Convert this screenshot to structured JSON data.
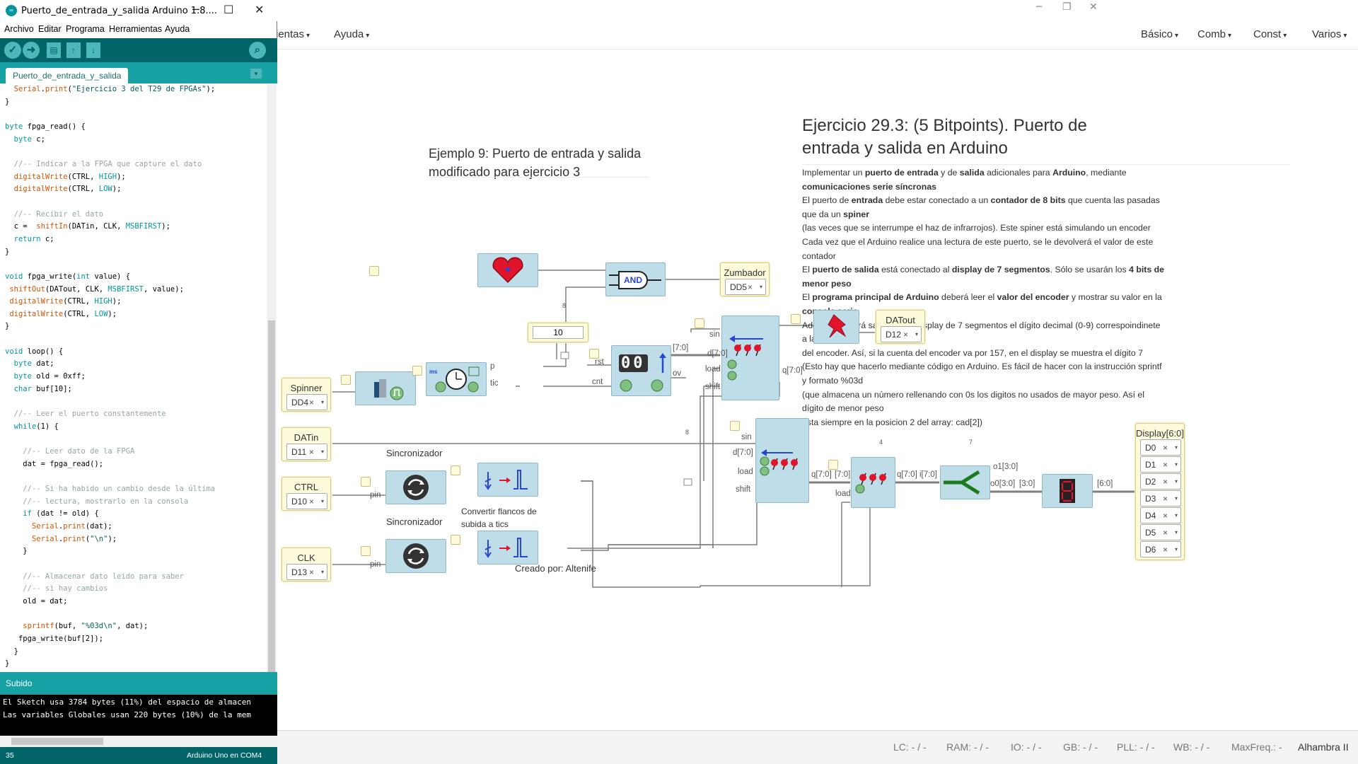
{
  "icestudio": {
    "window_controls": {
      "minimize": "─",
      "restore": "❐",
      "close": "✕"
    },
    "menus_left": [
      "ientas",
      "Ayuda"
    ],
    "menus_right": [
      "Básico",
      "Comb",
      "Const",
      "Varios"
    ],
    "example_title_line1": "Ejemplo 9: Puerto de entrada y salida",
    "example_title_line2": "modificado para ejercicio 3",
    "exercise_title_line1": "Ejercicio 29.3: (5 Bitpoints). Puerto de",
    "exercise_title_line2": "entrada y salida en Arduino",
    "description": [
      "Implementar un <b>puerto de entrada</b> y de <b>salida</b> adicionales para <b>Arduino</b>, mediante",
      "<b>comunicaciones serie síncronas</b>",
      "El puerto de <b>entrada</b> debe estar conectado a un <b>contador de 8 bits</b> que cuenta las pasadas",
      "que da un <b>spiner</b>",
      "(las veces que se interrumpe el haz de infrarrojos). Este spiner está simulando un encoder",
      "Cada vez que el Arduino realice una lectura de este puerto, se le devolverá el valor de este",
      "contador",
      "El <b>puerto de salida</b> está conectado al <b>display de 7 segmentos</b>. Sólo se usarán los <b>4 bits de</b>",
      "<b>menor peso</b>",
      "El <b>programa principal de Arduino</b> deberá leer el <b>valor del encoder</b> y mostrar su valor en la",
      "<b>consola serie.</b>",
      "Además, deberá sacar por el display de 7 segmentos el dígito decimal (0-9) correspoindinete",
      "a la lectura",
      "del encoder. Así, si la cuenta del encoder va por 157, en el display se muestra el dígito 7",
      "(Esto hay que hacerlo mediante código en Arduino. Es fácil de hacer con la instrucción sprintf",
      "y formato %03d",
      "(que almacena un número rellenando con 0s los digitos no usados de mayor peso. Así el",
      "dígito de menor peso",
      "esta siempre en la posicion 2 del array: cad[2])"
    ],
    "credit_prefix": "Creado por: ",
    "credit_name": "Altenife",
    "inputs": {
      "spinner": {
        "label": "Spinner",
        "value": "DD4"
      },
      "datin": {
        "label": "DATin",
        "value": "D11"
      },
      "ctrl": {
        "label": "CTRL",
        "value": "D10"
      },
      "clk": {
        "label": "CLK",
        "value": "D13"
      }
    },
    "outputs": {
      "zumbador": {
        "label": "Zumbador",
        "value": "DD5"
      },
      "datout": {
        "label": "DATout",
        "value": "D12"
      },
      "display": {
        "label": "Display[6:0]",
        "values": [
          "D0",
          "D1",
          "D2",
          "D3",
          "D4",
          "D5",
          "D6"
        ]
      }
    },
    "sel_clear": "×",
    "sel_arrow": "▾",
    "blocks": {
      "and_label": "AND",
      "const_value": "10",
      "sync1": "Sincronizador",
      "sync2": "Sincronizador",
      "edge_label_1": "Convertir flancos de",
      "edge_label_2": "subida a tics",
      "counter_digits": "00"
    },
    "pins": {
      "p": "p",
      "tic": "tic",
      "rst": "rst",
      "cnt": "cnt",
      "ov": "ov",
      "bus70a": "[7:0]",
      "d70a": "d[7:0]",
      "sin_a": "sin",
      "load_a": "load",
      "shift_a": "shift",
      "q70a": "q[7:0]",
      "sin_b": "sin",
      "d70b": "d[7:0]",
      "load_b": "load",
      "shift_b": "shift",
      "q70b": "q[7:0]",
      "bus70b": "[7:0]",
      "load_c": "load",
      "q70c": "q[7:0]",
      "i70": "i[7:0]",
      "o1": "o1[3:0]",
      "o0": "o0[3:0]",
      "bus30": "[3:0]",
      "bus60": "[6:0]",
      "pin1": "pin",
      "pin2": "pin",
      "n8a": "8",
      "n8b": "8",
      "n8c": "8",
      "n4": "4",
      "n7": "7"
    },
    "status": [
      "LC: - / -",
      "RAM: - / -",
      "IO: - / -",
      "GB: - / -",
      "PLL: - / -",
      "WB: - / -",
      "MaxFreq.: -"
    ],
    "board": "Alhambra II",
    "colors": {
      "block": "#bedde9",
      "io_bg": "#fefbdc",
      "wire": "#7f7f7f"
    }
  },
  "arduino": {
    "title": "Puerto_de_entrada_y_salida Arduino 1.8....",
    "window_controls": {
      "minimize": "─",
      "maximize": "☐",
      "close": "✕"
    },
    "menu": [
      "Archivo",
      "Editar",
      "Programa",
      "Herramientas",
      "Ayuda"
    ],
    "toolbar": {
      "verify": "✓",
      "upload": "➜",
      "new": "▤",
      "open": "↑",
      "save": "↓",
      "serial": "⌕"
    },
    "tab": "Puerto_de_entrada_y_salida",
    "tab_menu": "▾",
    "code_lines": [
      "  Serial.print(\"Ejercicio 3 del T29 de FPGAs\");",
      "}",
      "",
      "byte fpga_read() {",
      "  byte c;",
      "",
      "  //-- Indicar a la FPGA que capture el dato",
      "  digitalWrite(CTRL, HIGH);",
      "  digitalWrite(CTRL, LOW);",
      "",
      "  //-- Recibir el dato",
      "  c =  shiftIn(DATin, CLK, MSBFIRST);",
      "  return c;",
      "}",
      "",
      "void fpga_write(int value) {",
      " shiftOut(DATout, CLK, MSBFIRST, value);",
      " digitalWrite(CTRL, HIGH);",
      " digitalWrite(CTRL, LOW);",
      "}",
      "",
      "void loop() {",
      "  byte dat;",
      "  byte old = 0xff;",
      "  char buf[10];",
      "",
      "  //-- Leer el puerto constantemente",
      "  while(1) {",
      "",
      "    //-- Leer dato de la FPGA",
      "    dat = fpga_read();",
      "",
      "    //-- Si ha habido un cambio desde la última",
      "    //-- lectura, mostrarlo en la consola",
      "    if (dat != old) {",
      "      Serial.print(dat);",
      "      Serial.print(\"\\n\");",
      "    }",
      "",
      "    //-- Almacenar dato leido para saber",
      "    //-- si hay cambios",
      "    old = dat;",
      "",
      "    sprintf(buf, \"%03d\\n\", dat);",
      "   fpga_write(buf[2]);",
      "  }",
      "}"
    ],
    "message": "Subido",
    "console": [
      "El Sketch usa 3784 bytes (11%) del espacio de almacen",
      "Las variables Globales usan 220 bytes (10%) de la mem"
    ],
    "footer_line": "35",
    "footer_board": "Arduino Uno en COM4",
    "colors": {
      "toolbar": "#006468",
      "tabbar": "#17a1a5",
      "keyword": "#00979c",
      "function": "#d35400",
      "comment": "#95a5a6"
    }
  }
}
